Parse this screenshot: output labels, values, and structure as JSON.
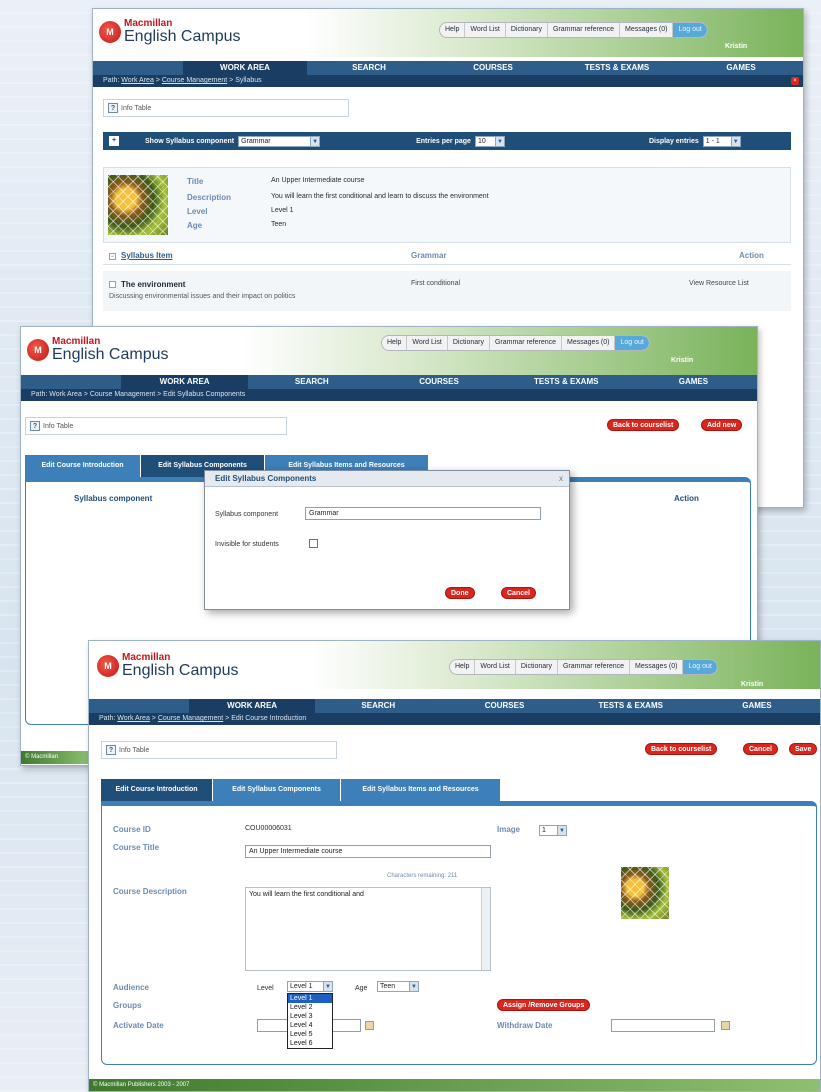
{
  "brand": {
    "macmillan": "Macmillan",
    "campus": "English Campus"
  },
  "toplinks": [
    "Help",
    "Word List",
    "Dictionary",
    "Grammar reference",
    "Messages (0)",
    "Log out"
  ],
  "username": "Kristin",
  "nav": [
    "WORK AREA",
    "SEARCH",
    "COURSES",
    "TESTS & EXAMS",
    "GAMES"
  ],
  "win1": {
    "path_prefix": "Path: ",
    "path_link1": "Work Area",
    "path_sep": " > ",
    "path_link2": "Course Management",
    "path_rest": " > Syllabus",
    "info": "Info Table",
    "show_label": "Show Syllabus component",
    "show_value": "Grammar",
    "entries_label": "Entries per page",
    "entries_value": "10",
    "display_label": "Display entries",
    "display_value": "1 - 1",
    "labels": {
      "title": "Title",
      "description": "Description",
      "level": "Level",
      "age": "Age"
    },
    "values": {
      "title": "An Upper Intermediate course",
      "description": "You will learn the first conditional and learn to discuss the environment",
      "level": "Level 1",
      "age": "Teen"
    },
    "columns": {
      "item": "Syllabus Item",
      "grammar": "Grammar",
      "action": "Action"
    },
    "row": {
      "title": "The environment",
      "subtitle": "Discussing environmental issues and their impact on politics",
      "grammar": "First conditional",
      "action": "View Resource List"
    }
  },
  "win2": {
    "path": "Path: Work Area > Course Management > Edit Syllabus Components",
    "info": "Info Table",
    "btn_back": "Back to courselist",
    "btn_add": "Add new",
    "tabs": [
      "Edit Course Introduction",
      "Edit Syllabus Components",
      "Edit Syllabus Items and Resources"
    ],
    "col_component": "Syllabus component",
    "col_action": "Action",
    "dialog": {
      "title": "Edit Syllabus Components",
      "close": "x",
      "field_label": "Syllabus component",
      "field_value": "Grammar",
      "invisible_label": "Invisible for students",
      "done": "Done",
      "cancel": "Cancel"
    },
    "footer": "© Macmillan"
  },
  "win3": {
    "path_prefix": "Path: ",
    "path_link1": "Work Area",
    "path_sep": " > ",
    "path_link2": "Course Management",
    "path_rest": " > Edit Course Introduction",
    "info": "Info Table",
    "btn_back": "Back to courselist",
    "btn_cancel": "Cancel",
    "btn_save": "Save",
    "tabs": [
      "Edit Course Introduction",
      "Edit Syllabus Components",
      "Edit Syllabus Items and Resources"
    ],
    "labels": {
      "course_id": "Course ID",
      "course_title": "Course Title",
      "course_description": "Course Description",
      "audience": "Audience",
      "groups": "Groups",
      "activate_date": "Activate Date",
      "image": "Image",
      "withdraw_date": "Withdraw Date"
    },
    "course_id": "COU00006031",
    "course_title": "An Upper Intermediate course",
    "chars_remaining": "Characters remaining: 211",
    "description": "You will learn the first conditional and",
    "level_label": "Level",
    "level_value": "Level 1",
    "age_label": "Age",
    "age_value": "Teen",
    "image_value": "1",
    "level_options": [
      "Level 1",
      "Level 2",
      "Level 3",
      "Level 4",
      "Level 5",
      "Level 6"
    ],
    "assign_btn": "Assign /Remove Groups",
    "footer": "© Macmillan Publishers 2003 - 2007"
  }
}
